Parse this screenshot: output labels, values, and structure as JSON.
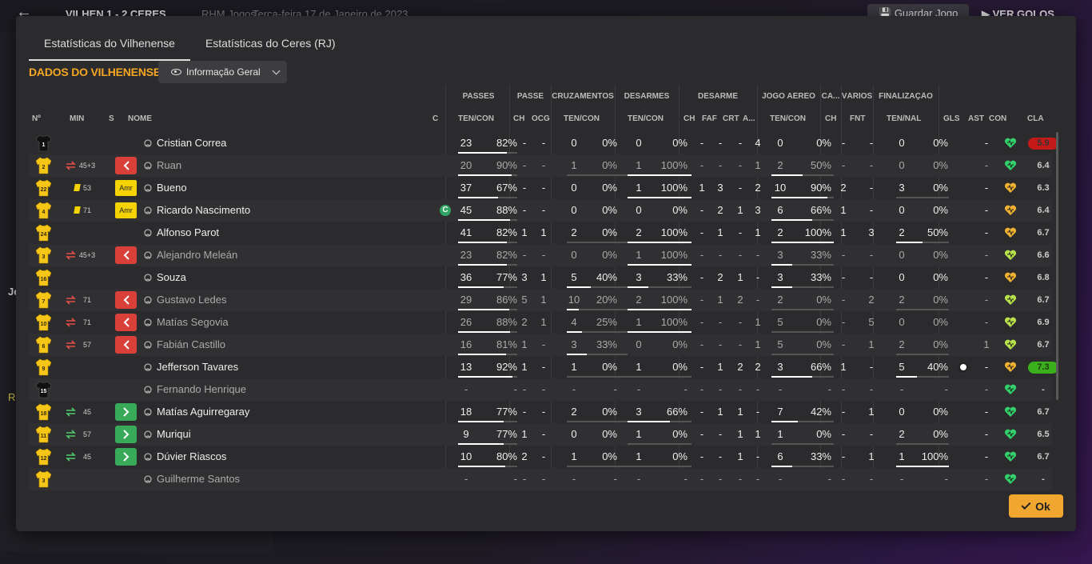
{
  "topbar": {
    "match": "VILHEN 1 - 2 CERES",
    "meta": "RHM Jogos",
    "date": "Terça-feira 17 de Janeiro de 2023",
    "save_label": "Guardar Jogo",
    "goals_label": "VER GOLOS"
  },
  "background": {
    "letter1": "Je",
    "letter2": "R"
  },
  "tabs": [
    {
      "label": "Estatísticas do Vilhenense",
      "active": true
    },
    {
      "label": "Estatísticas do Ceres (RJ)",
      "active": false
    }
  ],
  "section_title": "DADOS DO VILHENENSE",
  "view_select": "Informação Geral",
  "groups": {
    "passes": "PASSES",
    "passe": "PASSE",
    "cruz": "CRUZAMENTOS",
    "des": "DESARMES",
    "desarme": "DESARME",
    "aereo": "JOGO AÉREO",
    "ca": "CA...",
    "varios": "VÁRIOS",
    "final": "FINALIZAÇÃO"
  },
  "columns": {
    "num": "Nº",
    "min": "MIN",
    "s": "S",
    "nome": "NOME",
    "c": "C",
    "pass_tc": "TEN/CON",
    "p_ch": "CH",
    "p_ocg": "OCG",
    "cr_tc": "TEN/CON",
    "ds_tc": "TEN/CON",
    "d_ch": "CH",
    "d_faf": "FAF",
    "d_crt": "CRT",
    "d_a": "A...",
    "a_tc": "TEN/CON",
    "ca_ch": "CH",
    "v_fnt": "FNT",
    "f_tn": "TEN/NAL",
    "gls": "GLS",
    "ast": "AST",
    "con": "CON",
    "cla": "CLA"
  },
  "colors": {
    "accent": "#f5a623",
    "rating_red": "#c31919",
    "rating_green": "#3ab01c"
  },
  "rows": [
    {
      "num": "1",
      "gk": true,
      "min": "",
      "sub": "",
      "card": false,
      "tag": "",
      "name": "Cristian Correa",
      "dim": false,
      "cap": false,
      "pa": "23",
      "pp": "82%",
      "pch": "-",
      "pocg": "-",
      "ca": "0",
      "cp": "0%",
      "da": "0",
      "dp": "0%",
      "dch": "-",
      "faf": "-",
      "crt": "-",
      "dA": "4",
      "aa": "0",
      "ap": "0%",
      "cch": "-",
      "fnt": "-",
      "fa": "0",
      "fp": "0%",
      "gls": "",
      "ast": "-",
      "con": "green",
      "cla": "5.9",
      "cla_c": "red"
    },
    {
      "num": "2",
      "gk": false,
      "min": "45+3",
      "sub": "out",
      "card": false,
      "tag": "",
      "name": "Ruan",
      "dim": true,
      "cap": false,
      "pa": "20",
      "pp": "90%",
      "pch": "-",
      "pocg": "-",
      "ca": "1",
      "cp": "0%",
      "da": "1",
      "dp": "100%",
      "dch": "-",
      "faf": "-",
      "crt": "-",
      "dA": "1",
      "aa": "2",
      "ap": "50%",
      "cch": "-",
      "fnt": "-",
      "fa": "0",
      "fp": "0%",
      "gls": "",
      "ast": "-",
      "con": "green",
      "cla": "6.4",
      "cla_c": ""
    },
    {
      "num": "22",
      "gk": false,
      "min": "53",
      "sub": "",
      "card": true,
      "tag": "Amr",
      "name": "Bueno",
      "dim": false,
      "cap": false,
      "pa": "37",
      "pp": "67%",
      "pch": "-",
      "pocg": "-",
      "ca": "0",
      "cp": "0%",
      "da": "1",
      "dp": "100%",
      "dch": "1",
      "faf": "3",
      "crt": "-",
      "dA": "2",
      "aa": "10",
      "ap": "90%",
      "cch": "2",
      "fnt": "-",
      "fa": "3",
      "fp": "0%",
      "gls": "",
      "ast": "-",
      "con": "orange",
      "cla": "6.3",
      "cla_c": ""
    },
    {
      "num": "4",
      "gk": false,
      "min": "71",
      "sub": "",
      "card": true,
      "tag": "Amr",
      "name": "Ricardo Nascimento",
      "dim": false,
      "cap": true,
      "pa": "45",
      "pp": "88%",
      "pch": "-",
      "pocg": "-",
      "ca": "0",
      "cp": "0%",
      "da": "0",
      "dp": "0%",
      "dch": "-",
      "faf": "2",
      "crt": "1",
      "dA": "3",
      "aa": "6",
      "ap": "66%",
      "cch": "1",
      "fnt": "-",
      "fa": "0",
      "fp": "0%",
      "gls": "",
      "ast": "-",
      "con": "orange",
      "cla": "6.4",
      "cla_c": ""
    },
    {
      "num": "24",
      "gk": false,
      "min": "",
      "sub": "",
      "card": false,
      "tag": "",
      "name": "Alfonso Parot",
      "dim": false,
      "cap": false,
      "pa": "41",
      "pp": "82%",
      "pch": "1",
      "pocg": "1",
      "ca": "2",
      "cp": "0%",
      "da": "2",
      "dp": "100%",
      "dch": "-",
      "faf": "1",
      "crt": "-",
      "dA": "1",
      "aa": "2",
      "ap": "100%",
      "cch": "1",
      "fnt": "3",
      "fa": "2",
      "fp": "50%",
      "gls": "",
      "ast": "-",
      "con": "orange",
      "cla": "6.7",
      "cla_c": ""
    },
    {
      "num": "3",
      "gk": false,
      "min": "45+3",
      "sub": "out",
      "card": false,
      "tag": "",
      "name": "Alejandro Meleán",
      "dim": true,
      "cap": false,
      "pa": "23",
      "pp": "82%",
      "pch": "-",
      "pocg": "-",
      "ca": "0",
      "cp": "0%",
      "da": "1",
      "dp": "100%",
      "dch": "-",
      "faf": "-",
      "crt": "-",
      "dA": "-",
      "aa": "3",
      "ap": "33%",
      "cch": "-",
      "fnt": "-",
      "fa": "0",
      "fp": "0%",
      "gls": "",
      "ast": "-",
      "con": "lime",
      "cla": "6.6",
      "cla_c": ""
    },
    {
      "num": "16",
      "gk": false,
      "min": "",
      "sub": "",
      "card": false,
      "tag": "",
      "name": "Souza",
      "dim": false,
      "cap": false,
      "pa": "36",
      "pp": "77%",
      "pch": "3",
      "pocg": "1",
      "ca": "5",
      "cp": "40%",
      "da": "3",
      "dp": "33%",
      "dch": "-",
      "faf": "2",
      "crt": "1",
      "dA": "-",
      "aa": "3",
      "ap": "33%",
      "cch": "-",
      "fnt": "-",
      "fa": "0",
      "fp": "0%",
      "gls": "",
      "ast": "-",
      "con": "orange",
      "cla": "6.8",
      "cla_c": ""
    },
    {
      "num": "7",
      "gk": false,
      "min": "71",
      "sub": "out",
      "card": false,
      "tag": "",
      "name": "Gustavo Ledes",
      "dim": true,
      "cap": false,
      "pa": "29",
      "pp": "86%",
      "pch": "5",
      "pocg": "1",
      "ca": "10",
      "cp": "20%",
      "da": "2",
      "dp": "100%",
      "dch": "-",
      "faf": "1",
      "crt": "2",
      "dA": "-",
      "aa": "2",
      "ap": "0%",
      "cch": "-",
      "fnt": "2",
      "fa": "2",
      "fp": "0%",
      "gls": "",
      "ast": "-",
      "con": "lime",
      "cla": "6.7",
      "cla_c": ""
    },
    {
      "num": "10",
      "gk": false,
      "min": "71",
      "sub": "out",
      "card": false,
      "tag": "",
      "name": "Matías Segovia",
      "dim": true,
      "cap": false,
      "pa": "26",
      "pp": "88%",
      "pch": "2",
      "pocg": "1",
      "ca": "4",
      "cp": "25%",
      "da": "1",
      "dp": "100%",
      "dch": "-",
      "faf": "-",
      "crt": "-",
      "dA": "1",
      "aa": "5",
      "ap": "0%",
      "cch": "-",
      "fnt": "5",
      "fa": "0",
      "fp": "0%",
      "gls": "",
      "ast": "-",
      "con": "lime",
      "cla": "6.9",
      "cla_c": ""
    },
    {
      "num": "6",
      "gk": false,
      "min": "57",
      "sub": "out",
      "card": false,
      "tag": "",
      "name": "Fabián Castillo",
      "dim": true,
      "cap": false,
      "pa": "16",
      "pp": "81%",
      "pch": "1",
      "pocg": "-",
      "ca": "3",
      "cp": "33%",
      "da": "0",
      "dp": "0%",
      "dch": "-",
      "faf": "-",
      "crt": "-",
      "dA": "1",
      "aa": "5",
      "ap": "0%",
      "cch": "-",
      "fnt": "1",
      "fa": "2",
      "fp": "0%",
      "gls": "",
      "ast": "1",
      "con": "lime",
      "cla": "6.7",
      "cla_c": ""
    },
    {
      "num": "9",
      "gk": false,
      "min": "",
      "sub": "",
      "card": false,
      "tag": "",
      "name": "Jefferson Tavares",
      "dim": false,
      "cap": false,
      "pa": "13",
      "pp": "92%",
      "pch": "1",
      "pocg": "-",
      "ca": "1",
      "cp": "0%",
      "da": "1",
      "dp": "0%",
      "dch": "-",
      "faf": "1",
      "crt": "2",
      "dA": "2",
      "aa": "3",
      "ap": "66%",
      "cch": "1",
      "fnt": "-",
      "fa": "5",
      "fp": "40%",
      "gls": "ball",
      "ast": "-",
      "con": "orange",
      "cla": "7.3",
      "cla_c": "grn"
    },
    {
      "num": "15",
      "gk": true,
      "min": "",
      "sub": "",
      "card": false,
      "tag": "",
      "name": "Fernando Henrique",
      "dim": true,
      "cap": false,
      "pa": "-",
      "pp": "-",
      "pch": "-",
      "pocg": "-",
      "ca": "-",
      "cp": "-",
      "da": "-",
      "dp": "-",
      "dch": "-",
      "faf": "-",
      "crt": "-",
      "dA": "-",
      "aa": "-",
      "ap": "-",
      "cch": "-",
      "fnt": "-",
      "fa": "-",
      "fp": "-",
      "gls": "",
      "ast": "-",
      "con": "green",
      "cla": "-",
      "cla_c": ""
    },
    {
      "num": "18",
      "gk": false,
      "min": "45",
      "sub": "in",
      "card": false,
      "tag": "",
      "name": "Matías Aguirregaray",
      "dim": false,
      "cap": false,
      "pa": "18",
      "pp": "77%",
      "pch": "-",
      "pocg": "-",
      "ca": "2",
      "cp": "0%",
      "da": "3",
      "dp": "66%",
      "dch": "-",
      "faf": "1",
      "crt": "1",
      "dA": "-",
      "aa": "7",
      "ap": "42%",
      "cch": "-",
      "fnt": "1",
      "fa": "0",
      "fp": "0%",
      "gls": "",
      "ast": "-",
      "con": "green",
      "cla": "6.7",
      "cla_c": ""
    },
    {
      "num": "11",
      "gk": false,
      "min": "57",
      "sub": "in",
      "card": false,
      "tag": "",
      "name": "Muriqui",
      "dim": false,
      "cap": false,
      "pa": "9",
      "pp": "77%",
      "pch": "1",
      "pocg": "-",
      "ca": "0",
      "cp": "0%",
      "da": "1",
      "dp": "0%",
      "dch": "-",
      "faf": "-",
      "crt": "1",
      "dA": "1",
      "aa": "1",
      "ap": "0%",
      "cch": "-",
      "fnt": "-",
      "fa": "2",
      "fp": "0%",
      "gls": "",
      "ast": "-",
      "con": "green",
      "cla": "6.5",
      "cla_c": ""
    },
    {
      "num": "12",
      "gk": false,
      "min": "45",
      "sub": "in",
      "card": false,
      "tag": "",
      "name": "Dúvier Riascos",
      "dim": false,
      "cap": false,
      "pa": "10",
      "pp": "80%",
      "pch": "2",
      "pocg": "-",
      "ca": "1",
      "cp": "0%",
      "da": "1",
      "dp": "0%",
      "dch": "-",
      "faf": "-",
      "crt": "1",
      "dA": "-",
      "aa": "6",
      "ap": "33%",
      "cch": "-",
      "fnt": "1",
      "fa": "1",
      "fp": "100%",
      "gls": "",
      "ast": "-",
      "con": "green",
      "cla": "6.7",
      "cla_c": ""
    },
    {
      "num": "3",
      "gk": false,
      "min": "",
      "sub": "",
      "card": false,
      "tag": "",
      "name": "Guilherme Santos",
      "dim": true,
      "cap": false,
      "pa": "-",
      "pp": "-",
      "pch": "-",
      "pocg": "-",
      "ca": "-",
      "cp": "-",
      "da": "-",
      "dp": "-",
      "dch": "-",
      "faf": "-",
      "crt": "-",
      "dA": "-",
      "aa": "-",
      "ap": "-",
      "cch": "-",
      "fnt": "-",
      "fa": "-",
      "fp": "-",
      "gls": "",
      "ast": "-",
      "con": "green",
      "cla": "-",
      "cla_c": ""
    }
  ],
  "ok_label": "Ok"
}
